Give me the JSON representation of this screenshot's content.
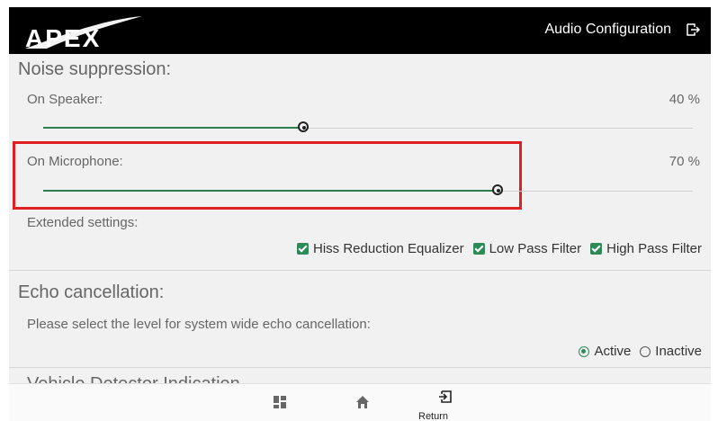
{
  "header": {
    "logo_text": "APEX",
    "title": "Audio Configuration",
    "exit_icon": "logout-icon"
  },
  "noise_suppression": {
    "title": "Noise suppression:",
    "speaker": {
      "label": "On Speaker:",
      "value_text": "40 %",
      "value": 40
    },
    "microphone": {
      "label": "On Microphone:",
      "value_text": "70 %",
      "value": 70
    },
    "extended_label": "Extended settings:",
    "options": [
      {
        "label": "Hiss Reduction Equalizer",
        "checked": true
      },
      {
        "label": "Low Pass Filter",
        "checked": true
      },
      {
        "label": "High Pass Filter",
        "checked": true
      }
    ]
  },
  "echo": {
    "title": "Echo cancellation:",
    "description": "Please select the level for system wide echo cancellation:",
    "options": [
      {
        "label": "Active",
        "selected": true
      },
      {
        "label": "Inactive",
        "selected": false
      }
    ]
  },
  "next_section_partial": "Vehicle Detector Indication",
  "bottom_nav": {
    "items": [
      {
        "icon": "dashboard-icon"
      },
      {
        "icon": "home-icon"
      },
      {
        "icon": "return-icon",
        "label": "Return"
      }
    ]
  },
  "colors": {
    "accent": "#2e7d4f",
    "highlight": "#e02020",
    "header_bg": "#000000"
  }
}
